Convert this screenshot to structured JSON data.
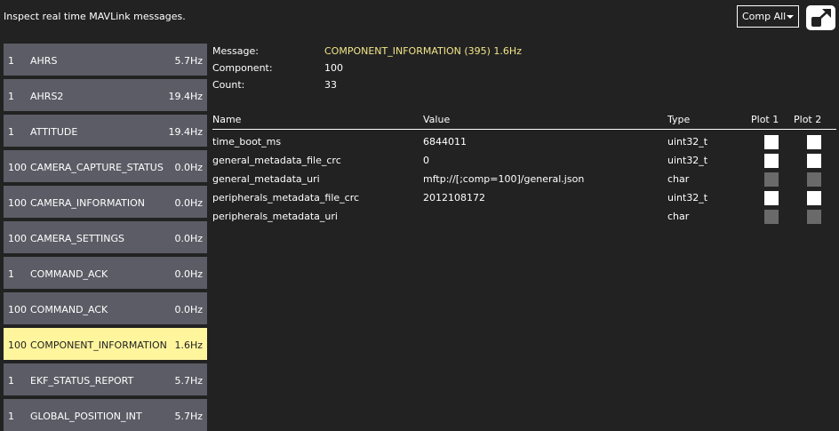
{
  "header": {
    "text": "Inspect real time MAVLink messages."
  },
  "comp_filter": {
    "selected": "Comp All"
  },
  "icons": {
    "popout": "popout-arrow-icon",
    "dropdown": "caret-down-icon"
  },
  "colors": {
    "selected_bg": "#fff59d",
    "item_bg": "#5c5c66",
    "highlight": "#f3e58a"
  },
  "messages": [
    {
      "comp": "1",
      "name": "AHRS",
      "rate": "5.7Hz"
    },
    {
      "comp": "1",
      "name": "AHRS2",
      "rate": "19.4Hz"
    },
    {
      "comp": "1",
      "name": "ATTITUDE",
      "rate": "19.4Hz"
    },
    {
      "comp": "100",
      "name": "CAMERA_CAPTURE_STATUS",
      "rate": "0.0Hz"
    },
    {
      "comp": "100",
      "name": "CAMERA_INFORMATION",
      "rate": "0.0Hz"
    },
    {
      "comp": "100",
      "name": "CAMERA_SETTINGS",
      "rate": "0.0Hz"
    },
    {
      "comp": "1",
      "name": "COMMAND_ACK",
      "rate": "0.0Hz"
    },
    {
      "comp": "100",
      "name": "COMMAND_ACK",
      "rate": "0.0Hz"
    },
    {
      "comp": "100",
      "name": "COMPONENT_INFORMATION",
      "rate": "1.6Hz",
      "selected": true
    },
    {
      "comp": "1",
      "name": "EKF_STATUS_REPORT",
      "rate": "5.7Hz"
    },
    {
      "comp": "1",
      "name": "GLOBAL_POSITION_INT",
      "rate": "5.7Hz"
    }
  ],
  "detail": {
    "message_label": "Message:",
    "message_value": "COMPONENT_INFORMATION (395) 1.6Hz",
    "component_label": "Component:",
    "component_value": "100",
    "count_label": "Count:",
    "count_value": "33"
  },
  "table": {
    "headers": {
      "name": "Name",
      "value": "Value",
      "type": "Type",
      "plot1": "Plot 1",
      "plot2": "Plot 2"
    },
    "rows": [
      {
        "name": "time_boot_ms",
        "value": "6844011",
        "type": "uint32_t",
        "plottable": true
      },
      {
        "name": "general_metadata_file_crc",
        "value": "0",
        "type": "uint32_t",
        "plottable": true
      },
      {
        "name": "general_metadata_uri",
        "value": "mftp://[;comp=100]/general.json",
        "type": "char",
        "plottable": false
      },
      {
        "name": "peripherals_metadata_file_crc",
        "value": "2012108172",
        "type": "uint32_t",
        "plottable": true
      },
      {
        "name": "peripherals_metadata_uri",
        "value": "",
        "type": "char",
        "plottable": false
      }
    ]
  }
}
